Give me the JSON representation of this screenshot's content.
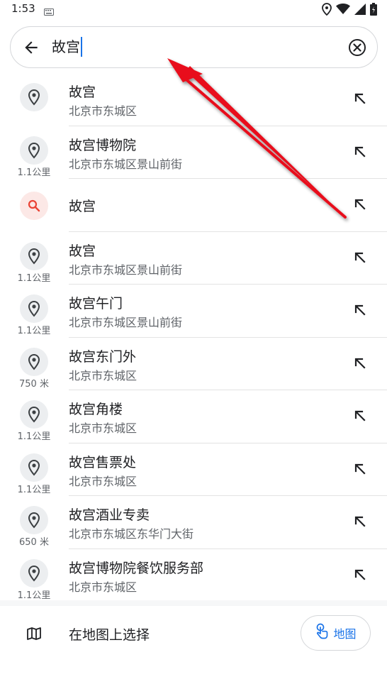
{
  "status_bar": {
    "time": "1:53",
    "icons": [
      "keyboard-icon",
      "location-icon",
      "wifi-icon",
      "signal-icon",
      "battery-charging-icon"
    ]
  },
  "search": {
    "query": "故宫",
    "back_icon": "arrow-back-icon",
    "clear_icon": "clear-circle-icon"
  },
  "results": [
    {
      "type": "place",
      "title": "故宫",
      "subtitle": "北京市东城区",
      "distance": ""
    },
    {
      "type": "place",
      "title": "故宫博物院",
      "subtitle": "北京市东城区景山前街",
      "distance": "1.1公里"
    },
    {
      "type": "query",
      "title": "故宫",
      "subtitle": "",
      "distance": ""
    },
    {
      "type": "place",
      "title": "故宫",
      "subtitle": "北京市东城区景山前街",
      "distance": "1.1公里"
    },
    {
      "type": "place",
      "title": "故宫午门",
      "subtitle": "北京市东城区景山前街",
      "distance": "1.1公里"
    },
    {
      "type": "place",
      "title": "故宫东门外",
      "subtitle": "北京市东城区",
      "distance": "750 米"
    },
    {
      "type": "place",
      "title": "故宫角楼",
      "subtitle": "北京市东城区",
      "distance": "1.1公里"
    },
    {
      "type": "place",
      "title": "故宫售票处",
      "subtitle": "北京市东城区",
      "distance": "1.1公里"
    },
    {
      "type": "place",
      "title": "故宫酒业专卖",
      "subtitle": "北京市东城区东华门大街",
      "distance": "650 米"
    },
    {
      "type": "place",
      "title": "故宫博物院餐饮服务部",
      "subtitle": "北京市东城区",
      "distance": "1.1公里"
    }
  ],
  "footer": {
    "label": "在地图上选择",
    "map_button_label": "地图"
  },
  "colors": {
    "accent": "#1a73e8",
    "search_icon_red": "#ea4335",
    "annotation_arrow": "#e8101a"
  }
}
